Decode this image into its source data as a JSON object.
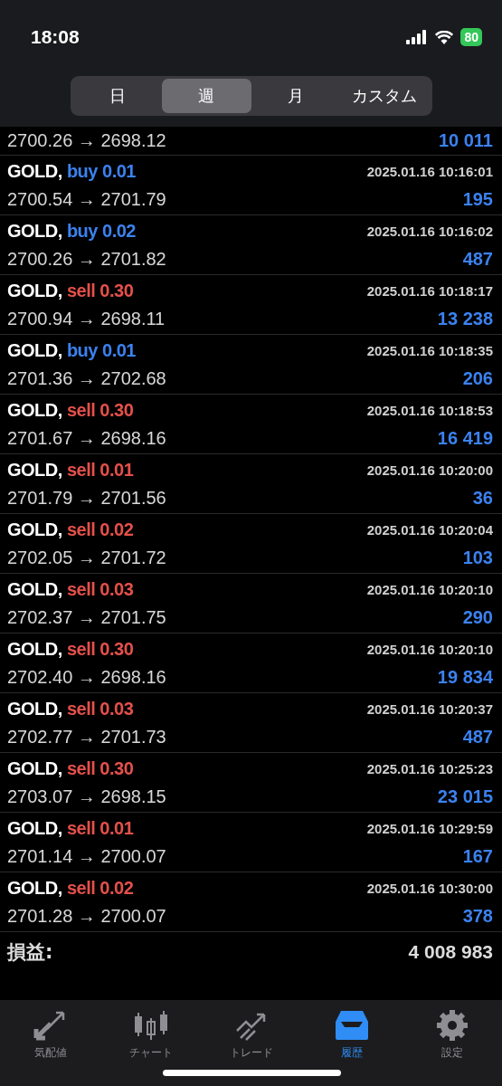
{
  "status_bar": {
    "time": "18:08",
    "battery": "80"
  },
  "period_tabs": [
    {
      "label": "日",
      "selected": false
    },
    {
      "label": "週",
      "selected": true
    },
    {
      "label": "月",
      "selected": false
    },
    {
      "label": "カスタム",
      "selected": false
    }
  ],
  "deals": [
    {
      "prices": "2700.26 → 2698.12",
      "profit": "10 011"
    },
    {
      "symbol": "GOLD,",
      "side": "buy",
      "volume": "0.01",
      "time": "2025.01.16 10:16:01",
      "prices": "2700.54 → 2701.79",
      "profit": "195"
    },
    {
      "symbol": "GOLD,",
      "side": "buy",
      "volume": "0.02",
      "time": "2025.01.16 10:16:02",
      "prices": "2700.26 → 2701.82",
      "profit": "487"
    },
    {
      "symbol": "GOLD,",
      "side": "sell",
      "volume": "0.30",
      "time": "2025.01.16 10:18:17",
      "prices": "2700.94 → 2698.11",
      "profit": "13 238"
    },
    {
      "symbol": "GOLD,",
      "side": "buy",
      "volume": "0.01",
      "time": "2025.01.16 10:18:35",
      "prices": "2701.36 → 2702.68",
      "profit": "206"
    },
    {
      "symbol": "GOLD,",
      "side": "sell",
      "volume": "0.30",
      "time": "2025.01.16 10:18:53",
      "prices": "2701.67 → 2698.16",
      "profit": "16 419"
    },
    {
      "symbol": "GOLD,",
      "side": "sell",
      "volume": "0.01",
      "time": "2025.01.16 10:20:00",
      "prices": "2701.79 → 2701.56",
      "profit": "36"
    },
    {
      "symbol": "GOLD,",
      "side": "sell",
      "volume": "0.02",
      "time": "2025.01.16 10:20:04",
      "prices": "2702.05 → 2701.72",
      "profit": "103"
    },
    {
      "symbol": "GOLD,",
      "side": "sell",
      "volume": "0.03",
      "time": "2025.01.16 10:20:10",
      "prices": "2702.37 → 2701.75",
      "profit": "290"
    },
    {
      "symbol": "GOLD,",
      "side": "sell",
      "volume": "0.30",
      "time": "2025.01.16 10:20:10",
      "prices": "2702.40 → 2698.16",
      "profit": "19 834"
    },
    {
      "symbol": "GOLD,",
      "side": "sell",
      "volume": "0.03",
      "time": "2025.01.16 10:20:37",
      "prices": "2702.77 → 2701.73",
      "profit": "487"
    },
    {
      "symbol": "GOLD,",
      "side": "sell",
      "volume": "0.30",
      "time": "2025.01.16 10:25:23",
      "prices": "2703.07 → 2698.15",
      "profit": "23 015"
    },
    {
      "symbol": "GOLD,",
      "side": "sell",
      "volume": "0.01",
      "time": "2025.01.16 10:29:59",
      "prices": "2701.14 → 2700.07",
      "profit": "167"
    },
    {
      "symbol": "GOLD,",
      "side": "sell",
      "volume": "0.02",
      "time": "2025.01.16 10:30:00",
      "prices": "2701.28 → 2700.07",
      "profit": "378"
    }
  ],
  "total": {
    "label": "損益:",
    "value": "4 008 983"
  },
  "nav": [
    {
      "kind": "quotes",
      "label": "気配値",
      "selected": false
    },
    {
      "kind": "chart",
      "label": "チャート",
      "selected": false
    },
    {
      "kind": "trade",
      "label": "トレード",
      "selected": false
    },
    {
      "kind": "history",
      "label": "履歴",
      "selected": true
    },
    {
      "kind": "settings",
      "label": "設定",
      "selected": false
    }
  ]
}
